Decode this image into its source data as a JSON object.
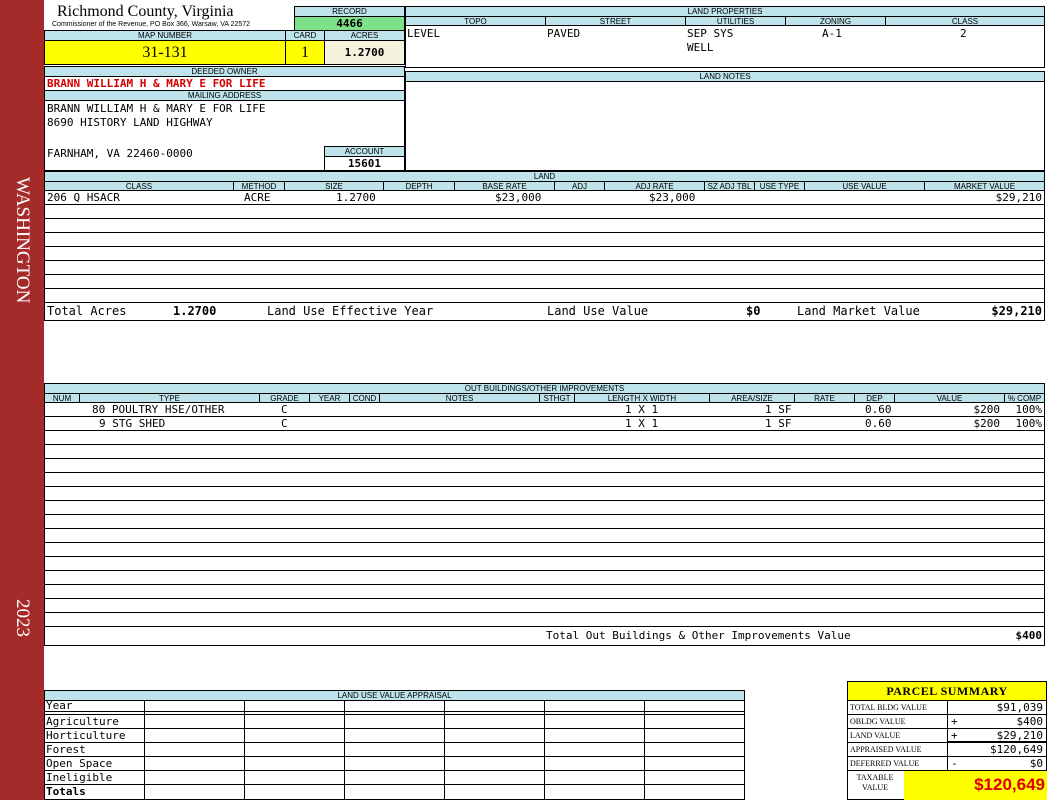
{
  "sidebar": {
    "district": "WASHINGTON",
    "year": "2023"
  },
  "header": {
    "county": "Richmond County, Virginia",
    "commissioner": "Commissioner of the Revenue, PO Box 366, Warsaw, VA 22572",
    "record_label": "RECORD",
    "record": "4466",
    "map_number_label": "MAP NUMBER",
    "map_number": "31-131",
    "card_label": "CARD",
    "card": "1",
    "acres_label": "ACRES",
    "acres": "1.2700"
  },
  "owner": {
    "deeded_owner_label": "DEEDED OWNER",
    "deeded_owner": "BRANN WILLIAM H & MARY E FOR LIFE",
    "mailing_label": "MAILING ADDRESS",
    "mailing_line1": "BRANN WILLIAM H & MARY E FOR LIFE",
    "mailing_line2": "8690 HISTORY LAND HIGHWAY",
    "mailing_line3": "FARNHAM, VA 22460-0000",
    "account_label": "ACCOUNT",
    "account": "15601"
  },
  "land_properties": {
    "title": "LAND PROPERTIES",
    "headers": [
      "TOPO",
      "STREET",
      "UTILITIES",
      "ZONING",
      "CLASS"
    ],
    "topo": "LEVEL",
    "street": "PAVED",
    "utilities_1": "SEP SYS",
    "utilities_2": "WELL",
    "zoning": "A-1",
    "class": "2"
  },
  "land_notes": {
    "title": "LAND NOTES"
  },
  "land": {
    "title": "LAND",
    "headers": [
      "CLASS",
      "METHOD",
      "SIZE",
      "DEPTH",
      "BASE RATE",
      "ADJ",
      "ADJ RATE",
      "SZ ADJ TBL",
      "USE TYPE",
      "USE VALUE",
      "MARKET VALUE"
    ],
    "rows": [
      {
        "class": "206 Q HSACR",
        "method": "ACRE",
        "size": "1.2700",
        "base_rate": "$23,000",
        "adj_rate": "$23,000",
        "market_value": "$29,210"
      }
    ],
    "total_acres_label": "Total Acres",
    "total_acres": "1.2700",
    "use_year_label": "Land Use Effective Year",
    "use_value_label": "Land Use Value",
    "use_value": "$0",
    "market_value_label": "Land Market Value",
    "market_value": "$29,210"
  },
  "outbuildings": {
    "title": "OUT BUILDINGS/OTHER IMPROVEMENTS",
    "headers": [
      "NUM",
      "TYPE",
      "GRADE",
      "YEAR",
      "COND",
      "NOTES",
      "STHGT",
      "LENGTH X WIDTH",
      "AREA/SIZE",
      "RATE",
      "DEP",
      "VALUE",
      "% COMP"
    ],
    "rows": [
      {
        "type": "80  POULTRY HSE/OTHER",
        "grade": "C",
        "lxw": "1 X 1",
        "area": "1 SF",
        "dep": "0.60",
        "value": "$200",
        "comp": "100%"
      },
      {
        "type": "9  STG SHED",
        "grade": "C",
        "lxw": "1 X 1",
        "area": "1 SF",
        "dep": "0.60",
        "value": "$200",
        "comp": "100%"
      }
    ],
    "total_label": "Total Out Buildings & Other Improvements Value",
    "total": "$400"
  },
  "land_use_appraisal": {
    "title": "LAND USE VALUE APPRAISAL",
    "rows": [
      "Year",
      "Agriculture",
      "Horticulture",
      "Forest",
      "Open Space",
      "Ineligible",
      "Totals"
    ]
  },
  "summary": {
    "title": "PARCEL SUMMARY",
    "bldg_label": "TOTAL BLDG VALUE",
    "bldg": "$91,039",
    "obldg_label": "OBLDG VALUE",
    "obldg_op": "+",
    "obldg": "$400",
    "land_label": "LAND VALUE",
    "land_op": "+",
    "land": "$29,210",
    "appraised_label": "APPRAISED VALUE",
    "appraised": "$120,649",
    "deferred_label": "DEFERRED VALUE",
    "deferred_op": "-",
    "deferred": "$0",
    "taxable_label_1": "TAXABLE",
    "taxable_label_2": "VALUE",
    "taxable": "$120,649"
  },
  "colors": {
    "sidebar": "#a52a2a",
    "header_bg": "#bfe3ea",
    "highlight": "#ffff00",
    "record_bg": "#7fe08a",
    "owner_red": "#d40000",
    "taxable_red": "#e00000"
  }
}
